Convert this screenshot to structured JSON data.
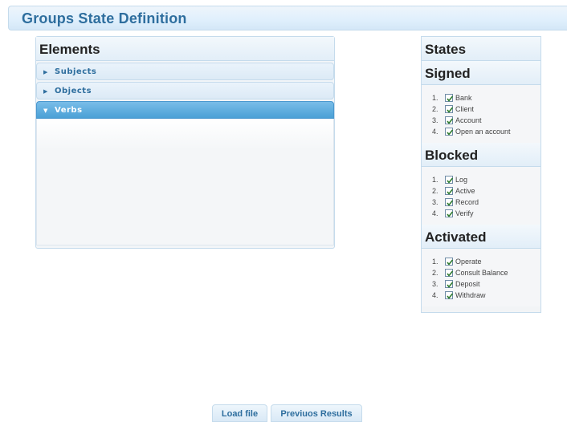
{
  "page": {
    "title": "Groups State Definition"
  },
  "elements": {
    "title": "Elements",
    "items": [
      {
        "label": "Subjects",
        "expanded": false
      },
      {
        "label": "Objects",
        "expanded": false
      },
      {
        "label": "Verbs",
        "expanded": true
      }
    ]
  },
  "states": {
    "title": "States",
    "groups": [
      {
        "name": "Signed",
        "items": [
          {
            "num": "1.",
            "label": "Bank",
            "checked": true
          },
          {
            "num": "2.",
            "label": "Client",
            "checked": true
          },
          {
            "num": "3.",
            "label": "Account",
            "checked": true
          },
          {
            "num": "4.",
            "label": "Open an account",
            "checked": true
          }
        ]
      },
      {
        "name": "Blocked",
        "items": [
          {
            "num": "1.",
            "label": "Log",
            "checked": true
          },
          {
            "num": "2.",
            "label": "Active",
            "checked": true
          },
          {
            "num": "3.",
            "label": "Record",
            "checked": true
          },
          {
            "num": "4.",
            "label": "Verify",
            "checked": true
          }
        ]
      },
      {
        "name": "Activated",
        "items": [
          {
            "num": "1.",
            "label": "Operate",
            "checked": true
          },
          {
            "num": "2.",
            "label": "Consult Balance",
            "checked": true
          },
          {
            "num": "3.",
            "label": "Deposit",
            "checked": true
          },
          {
            "num": "4.",
            "label": "Withdraw",
            "checked": true
          }
        ]
      }
    ]
  },
  "buttons": {
    "load_file": "Load file",
    "previous_results": "Previuos Results"
  },
  "colors": {
    "accent": "#2e6e9e",
    "active_header": "#4aa0d6",
    "border": "#c5dbec"
  }
}
